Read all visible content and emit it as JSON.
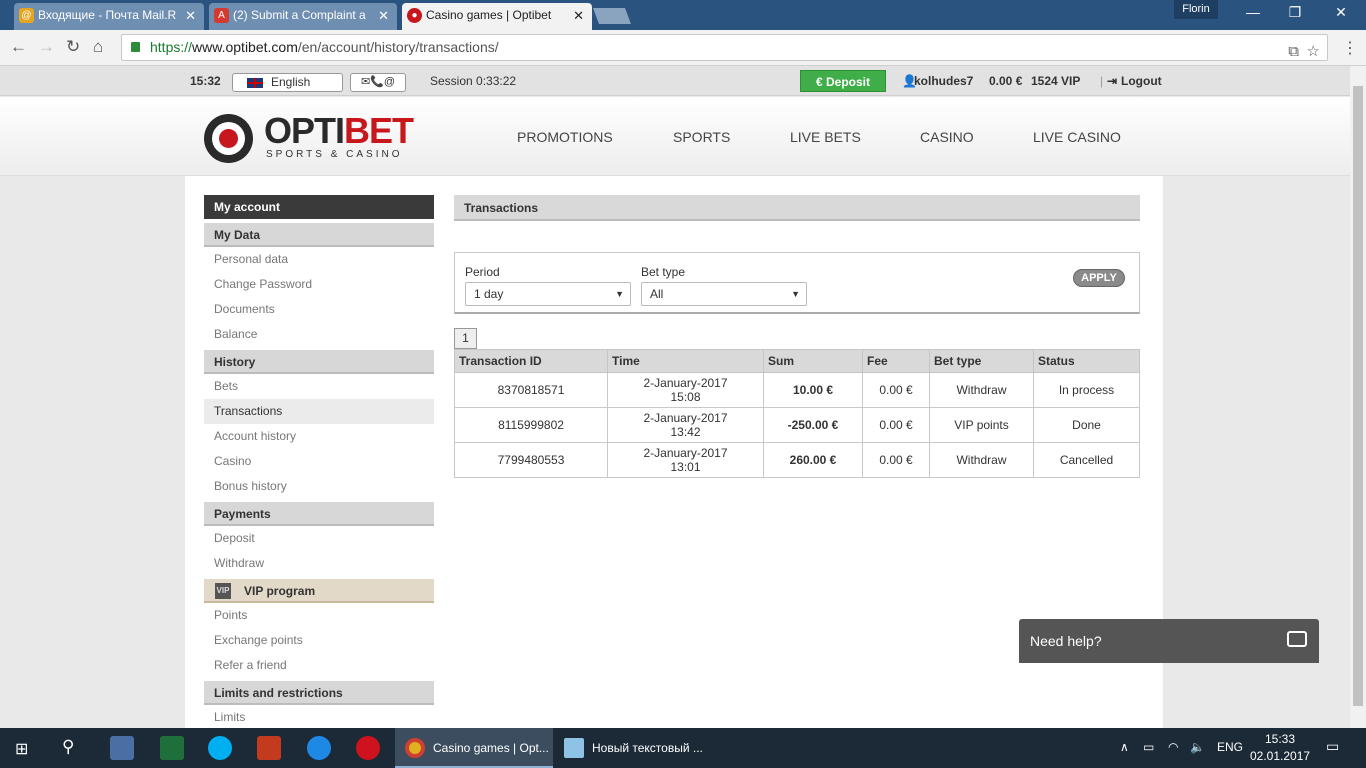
{
  "browser": {
    "tabs": [
      {
        "title": "Входящие - Почта Mail.R",
        "icon": "mail-icon",
        "color": "#e6a520"
      },
      {
        "title": "(2) Submit a Complaint a",
        "icon": "askgamblers-icon",
        "color": "#d43a2f"
      },
      {
        "title": "Casino games | Optibet",
        "icon": "optibet-icon",
        "color": "#c8161d"
      }
    ],
    "profile": "Florin",
    "url_proto": "https://",
    "url_host": "www.optibet.com",
    "url_path": "/en/account/history/transactions/"
  },
  "topbar": {
    "time": "15:32",
    "language": "English",
    "contact": "✉📞@",
    "session": "Session 0:33:22",
    "deposit_label": "€ Deposit",
    "username": "kolhudes7",
    "balance": "0.00 €",
    "vip": "1524 VIP",
    "logout": "Logout"
  },
  "header": {
    "logo_main": "OPTI",
    "logo_accent": "BET",
    "logo_sub": "SPORTS & CASINO",
    "nav": [
      "PROMOTIONS",
      "SPORTS",
      "LIVE BETS",
      "CASINO",
      "LIVE CASINO"
    ]
  },
  "sidebar": {
    "my_account": "My account",
    "my_data": "My Data",
    "my_data_items": [
      "Personal data",
      "Change Password",
      "Documents",
      "Balance"
    ],
    "history": "History",
    "history_items": [
      "Bets",
      "Transactions",
      "Account history",
      "Casino",
      "Bonus history"
    ],
    "payments": "Payments",
    "payments_items": [
      "Deposit",
      "Withdraw"
    ],
    "vip_icon": "VIP",
    "vip": "VIP program",
    "vip_items": [
      "Points",
      "Exchange points",
      "Refer a friend"
    ],
    "limits": "Limits and restrictions",
    "limits_items": [
      "Limits"
    ]
  },
  "main": {
    "title": "Transactions",
    "period_label": "Period",
    "period_value": "1 day",
    "bettype_label": "Bet type",
    "bettype_value": "All",
    "apply": "APPLY",
    "page": "1",
    "columns": [
      "Transaction ID",
      "Time",
      "Sum",
      "Fee",
      "Bet type",
      "Status"
    ],
    "rows": [
      {
        "id": "8370818571",
        "date": "2-January-2017",
        "time": "15:08",
        "sum": "10.00 €",
        "fee": "0.00 €",
        "type": "Withdraw",
        "status": "In process"
      },
      {
        "id": "8115999802",
        "date": "2-January-2017",
        "time": "13:42",
        "sum": "-250.00 €",
        "fee": "0.00 €",
        "type": "VIP points",
        "status": "Done"
      },
      {
        "id": "7799480553",
        "date": "2-January-2017",
        "time": "13:01",
        "sum": "260.00 €",
        "fee": "0.00 €",
        "type": "Withdraw",
        "status": "Cancelled"
      }
    ]
  },
  "help": {
    "label": "Need help?"
  },
  "taskbar": {
    "apps": [
      {
        "title": "Casino games | Opt...",
        "icon": "chrome-icon",
        "active": true
      },
      {
        "title": "Новый текстовый ...",
        "icon": "notepad-icon",
        "active": false
      }
    ],
    "lang": "ENG",
    "clock_time": "15:33",
    "clock_date": "02.01.2017"
  }
}
